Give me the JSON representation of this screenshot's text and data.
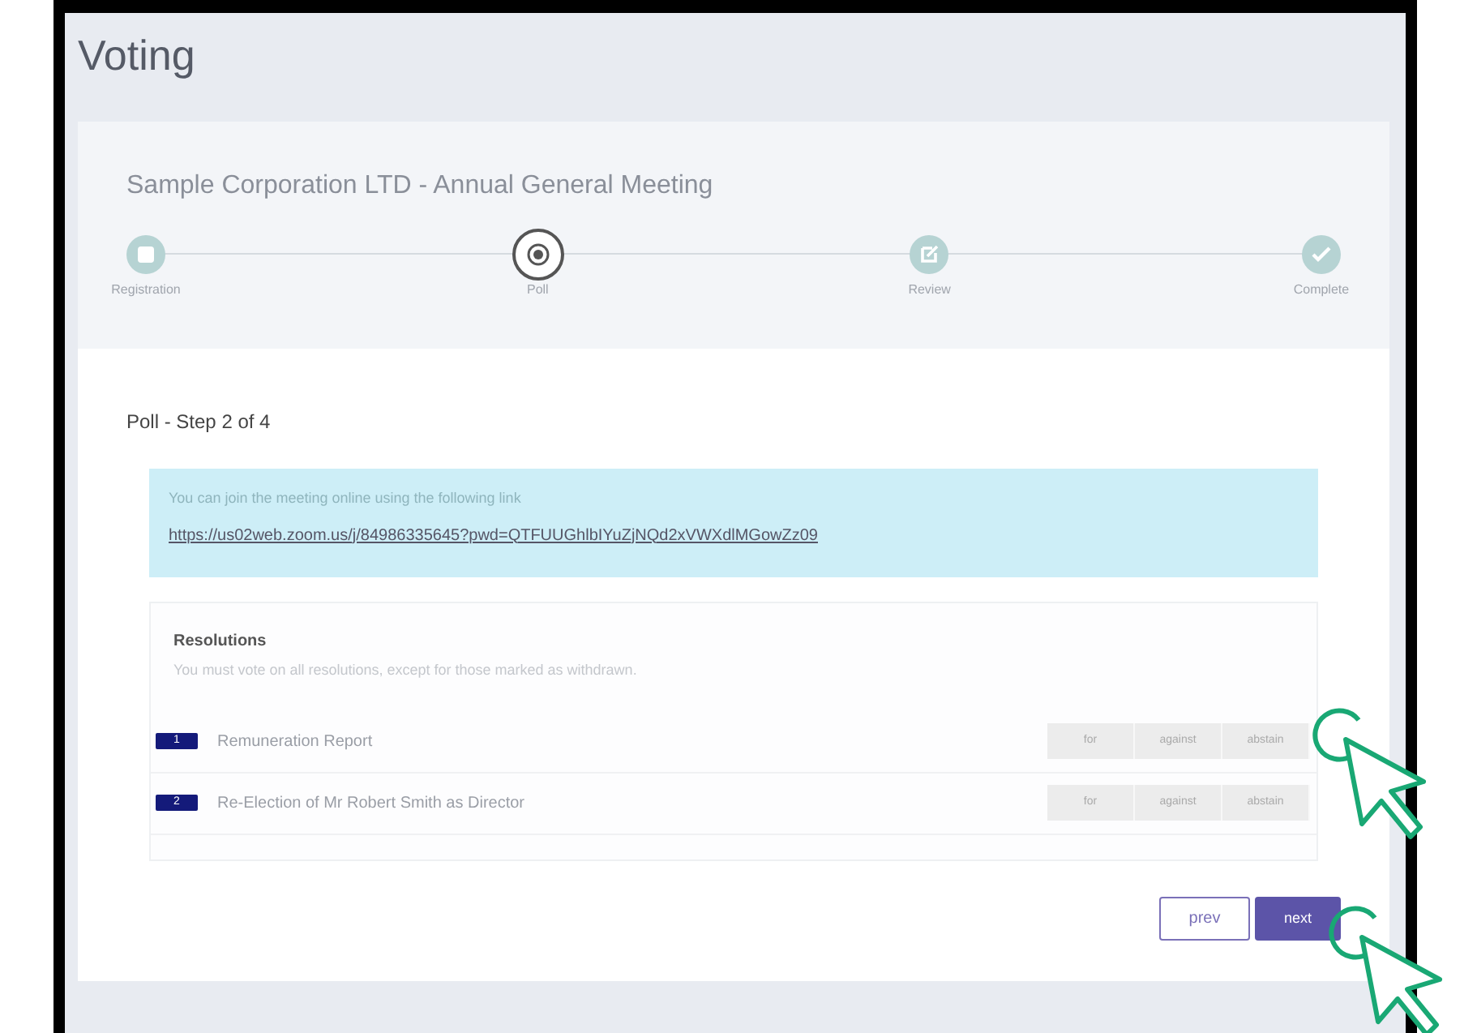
{
  "page_title": "Voting",
  "meeting": {
    "title": "Sample Corporation LTD - Annual General Meeting",
    "steps": [
      {
        "label": "Registration",
        "selected": false
      },
      {
        "label": "Poll",
        "selected": true
      },
      {
        "label": "Review",
        "selected": false
      },
      {
        "label": "Complete",
        "selected": false
      }
    ]
  },
  "step_heading": "Poll - Step 2 of 4",
  "info": {
    "text": "You can join the meeting online using the following link",
    "link": "https://us02web.zoom.us/j/84986335645?pwd=QTFUUGhlbIYuZjNQd2xVWXdlMGowZz09"
  },
  "resolutions": {
    "title": "Resolutions",
    "note": "You must vote on all resolutions, except for those marked as withdrawn.",
    "items": [
      {
        "number": "1",
        "title": "Remuneration Report",
        "options": [
          "for",
          "against",
          "abstain"
        ]
      },
      {
        "number": "2",
        "title": "Re-Election of Mr Robert Smith as Director",
        "options": [
          "for",
          "against",
          "abstain"
        ]
      }
    ]
  },
  "buttons": {
    "prev": "prev",
    "next": "next"
  }
}
